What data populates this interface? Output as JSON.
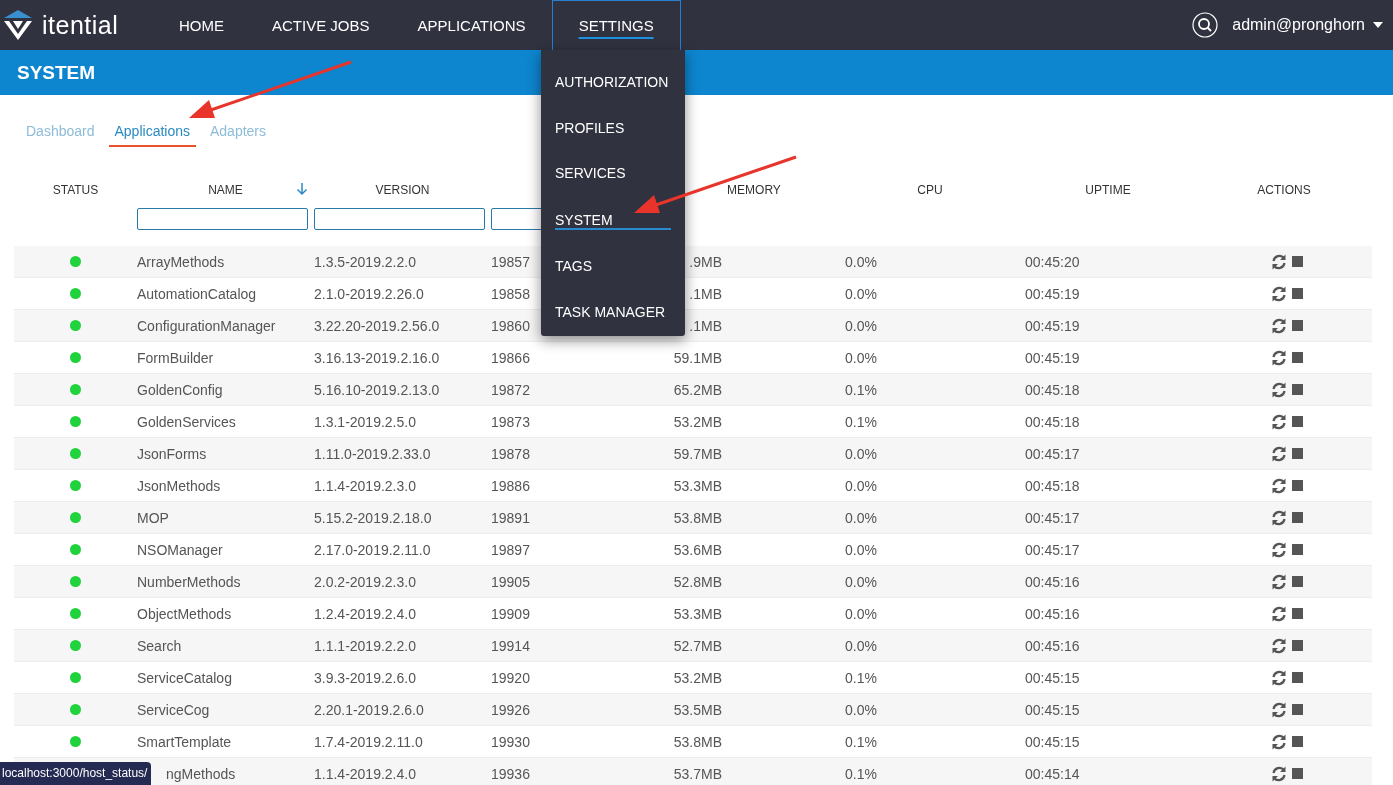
{
  "brand": {
    "name": "itential"
  },
  "nav": [
    {
      "label": "HOME",
      "selected": false
    },
    {
      "label": "ACTIVE JOBS",
      "selected": false
    },
    {
      "label": "APPLICATIONS",
      "selected": false
    },
    {
      "label": "SETTINGS",
      "selected": true
    }
  ],
  "user": {
    "name": "admin@pronghorn"
  },
  "page_title": "SYSTEM",
  "settings_menu": [
    {
      "label": "AUTHORIZATION",
      "selected": false
    },
    {
      "label": "PROFILES",
      "selected": false
    },
    {
      "label": "SERVICES",
      "selected": false
    },
    {
      "label": "SYSTEM",
      "selected": true
    },
    {
      "label": "TAGS",
      "selected": false
    },
    {
      "label": "TASK MANAGER",
      "selected": false
    }
  ],
  "tabs": [
    {
      "label": "Dashboard",
      "selected": false
    },
    {
      "label": "Applications",
      "selected": true
    },
    {
      "label": "Adapters",
      "selected": false
    }
  ],
  "table": {
    "columns": [
      {
        "label": "STATUS",
        "sorted": false
      },
      {
        "label": "NAME",
        "sorted": true
      },
      {
        "label": "VERSION",
        "sorted": false
      },
      {
        "label": "MEMORY",
        "sorted": false
      },
      {
        "label": "CPU",
        "sorted": false
      },
      {
        "label": "UPTIME",
        "sorted": false
      },
      {
        "label": "ACTIONS",
        "sorted": false
      }
    ],
    "rows": [
      {
        "running": true,
        "name": "ArrayMethods",
        "version": "1.3.5-2019.2.2.0",
        "pid": "19857",
        "memory": ".9MB",
        "cpu": "0.0%",
        "uptime": "00:45:20"
      },
      {
        "running": true,
        "name": "AutomationCatalog",
        "version": "2.1.0-2019.2.26.0",
        "pid": "19858",
        "memory": ".1MB",
        "cpu": "0.0%",
        "uptime": "00:45:19"
      },
      {
        "running": true,
        "name": "ConfigurationManager",
        "version": "3.22.20-2019.2.56.0",
        "pid": "19860",
        "memory": ".1MB",
        "cpu": "0.0%",
        "uptime": "00:45:19"
      },
      {
        "running": true,
        "name": "FormBuilder",
        "version": "3.16.13-2019.2.16.0",
        "pid": "19866",
        "memory": "59.1MB",
        "cpu": "0.0%",
        "uptime": "00:45:19"
      },
      {
        "running": true,
        "name": "GoldenConfig",
        "version": "5.16.10-2019.2.13.0",
        "pid": "19872",
        "memory": "65.2MB",
        "cpu": "0.1%",
        "uptime": "00:45:18"
      },
      {
        "running": true,
        "name": "GoldenServices",
        "version": "1.3.1-2019.2.5.0",
        "pid": "19873",
        "memory": "53.2MB",
        "cpu": "0.1%",
        "uptime": "00:45:18"
      },
      {
        "running": true,
        "name": "JsonForms",
        "version": "1.11.0-2019.2.33.0",
        "pid": "19878",
        "memory": "59.7MB",
        "cpu": "0.0%",
        "uptime": "00:45:17"
      },
      {
        "running": true,
        "name": "JsonMethods",
        "version": "1.1.4-2019.2.3.0",
        "pid": "19886",
        "memory": "53.3MB",
        "cpu": "0.0%",
        "uptime": "00:45:18"
      },
      {
        "running": true,
        "name": "MOP",
        "version": "5.15.2-2019.2.18.0",
        "pid": "19891",
        "memory": "53.8MB",
        "cpu": "0.0%",
        "uptime": "00:45:17"
      },
      {
        "running": true,
        "name": "NSOManager",
        "version": "2.17.0-2019.2.11.0",
        "pid": "19897",
        "memory": "53.6MB",
        "cpu": "0.0%",
        "uptime": "00:45:17"
      },
      {
        "running": true,
        "name": "NumberMethods",
        "version": "2.0.2-2019.2.3.0",
        "pid": "19905",
        "memory": "52.8MB",
        "cpu": "0.0%",
        "uptime": "00:45:16"
      },
      {
        "running": true,
        "name": "ObjectMethods",
        "version": "1.2.4-2019.2.4.0",
        "pid": "19909",
        "memory": "53.3MB",
        "cpu": "0.0%",
        "uptime": "00:45:16"
      },
      {
        "running": true,
        "name": "Search",
        "version": "1.1.1-2019.2.2.0",
        "pid": "19914",
        "memory": "52.7MB",
        "cpu": "0.0%",
        "uptime": "00:45:16"
      },
      {
        "running": true,
        "name": "ServiceCatalog",
        "version": "3.9.3-2019.2.6.0",
        "pid": "19920",
        "memory": "53.2MB",
        "cpu": "0.1%",
        "uptime": "00:45:15"
      },
      {
        "running": true,
        "name": "ServiceCog",
        "version": "2.20.1-2019.2.6.0",
        "pid": "19926",
        "memory": "53.5MB",
        "cpu": "0.0%",
        "uptime": "00:45:15"
      },
      {
        "running": true,
        "name": "SmartTemplate",
        "version": "1.7.4-2019.2.11.0",
        "pid": "19930",
        "memory": "53.8MB",
        "cpu": "0.1%",
        "uptime": "00:45:15"
      },
      {
        "covered": true,
        "name": "ngMethods",
        "version": "1.1.4-2019.2.4.0",
        "pid": "19936",
        "memory": "53.7MB",
        "cpu": "0.1%",
        "uptime": "00:45:14"
      }
    ]
  },
  "status_tooltip": "localhost:3000/host_status/"
}
